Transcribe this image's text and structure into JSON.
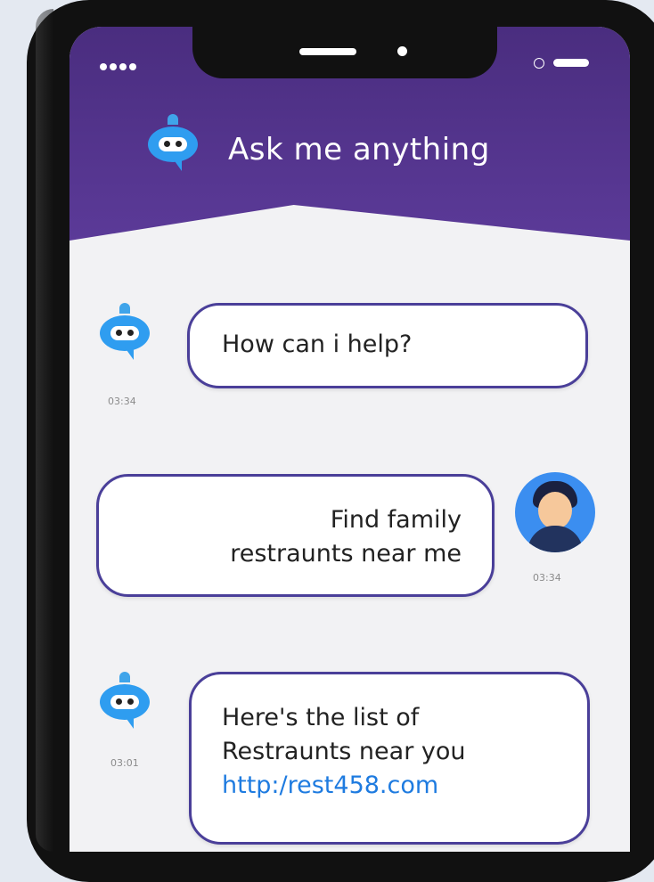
{
  "header": {
    "title": "Ask me anything"
  },
  "messages": [
    {
      "sender": "bot",
      "text": "How can i help?",
      "time": "03:34"
    },
    {
      "sender": "user",
      "lines": [
        "Find family",
        "restraunts near me"
      ],
      "time": "03:34"
    },
    {
      "sender": "bot",
      "lines": [
        "Here's the list of",
        "Restraunts near you"
      ],
      "link": "http:/rest458.com",
      "time": "03:01"
    }
  ],
  "colors": {
    "header": "#5b3a98",
    "bubble_border": "#4a3f99",
    "link": "#1e7be0",
    "bot": "#2f9df0",
    "user_avatar": "#3b8ef0"
  },
  "icons": [
    "bot-icon",
    "user-avatar",
    "signal-dots-icon",
    "battery-icon"
  ]
}
